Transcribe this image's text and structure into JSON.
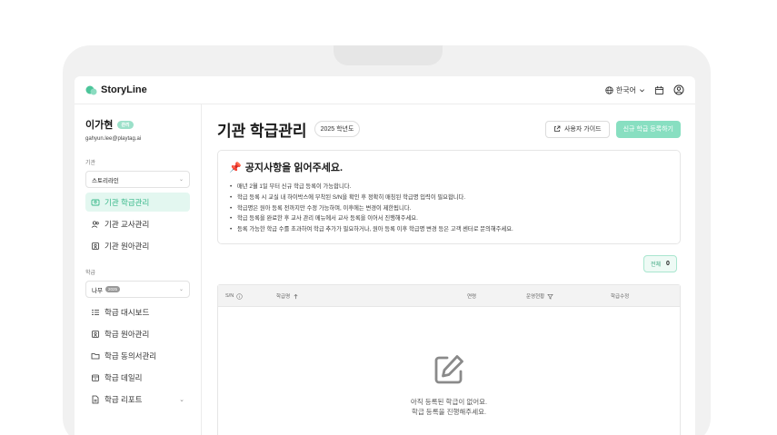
{
  "app": {
    "logo_text": "StoryLine"
  },
  "topbar": {
    "language": "한국어"
  },
  "user": {
    "name": "이가현",
    "role_badge": "관리",
    "email": "gahyun.lee@playtag.ai"
  },
  "sidebar": {
    "org_label": "기관",
    "org_select": "스토리라인",
    "org_items": [
      {
        "label": "기관 학급관리"
      },
      {
        "label": "기관 교사관리"
      },
      {
        "label": "기관 원아관리"
      }
    ],
    "class_label": "학급",
    "class_select": "나무",
    "class_select_badge": "2025",
    "class_items": [
      {
        "label": "학급 대시보드"
      },
      {
        "label": "학급 원아관리"
      },
      {
        "label": "학급 동의서관리"
      },
      {
        "label": "학급 데일리"
      },
      {
        "label": "학급 리포트"
      }
    ]
  },
  "main": {
    "title": "기관 학급관리",
    "year_chip": "2025 학년도",
    "guide_button": "사용자 가이드",
    "register_button": "신규 학급 등록하기",
    "notice": {
      "title": "공지사항을 읽어주세요.",
      "items": [
        "매년 2월 1일 부터 신규 학급 등록이 가능합니다.",
        "학급 등록 시 교실 내 하이박스에 부착된 S/N을 확인 후 정확히 매칭된 학급명 입력이 필요합니다.",
        "학급명은 원아 등록 전까지만 수정 가능하며, 이후에는 변경이 제한됩니다.",
        "학급 등록을 완료한 후 교사 관리 메뉴에서 교사 등록을 이어서 진행해주세요.",
        "등록 가능한 학급 수를 초과하여 학급 추가가 필요하거나, 원아 등록 이후 학급명 변경 등은 고객 센터로 문의해주세요."
      ]
    },
    "total_label": "전체",
    "total_count": "0",
    "table": {
      "columns": [
        "S/N",
        "학급명",
        "연령",
        "운영현황",
        "학급수정"
      ],
      "empty_line1": "아직 등록된 학급이 없어요.",
      "empty_line2": "학급 등록을 진행해주세요."
    }
  },
  "colors": {
    "accent": "#39b88a",
    "accent_light": "#88dfc1",
    "active_bg": "#e3f7f0"
  }
}
